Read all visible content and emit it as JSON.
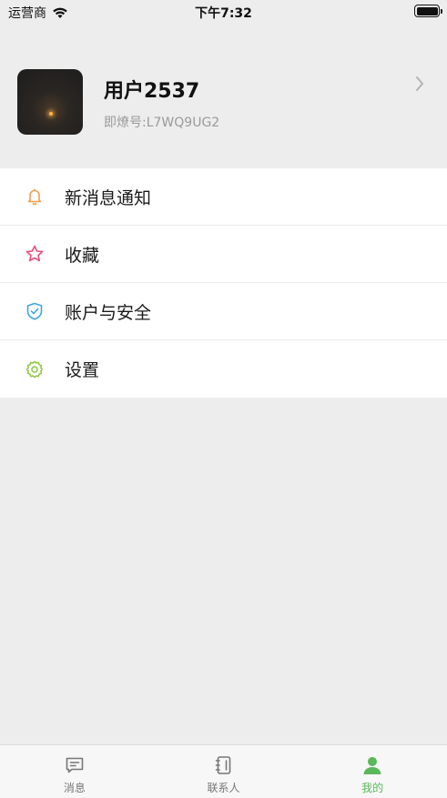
{
  "status_bar": {
    "carrier": "运营商",
    "time": "下午7:32"
  },
  "profile": {
    "username": "用户2537",
    "account_id": "即燎号:L7WQ9UG2"
  },
  "menu": {
    "items": [
      {
        "label": "新消息通知",
        "icon": "bell-icon",
        "color": "#f0a050"
      },
      {
        "label": "收藏",
        "icon": "star-icon",
        "color": "#e8507a"
      },
      {
        "label": "账户与安全",
        "icon": "shield-check-icon",
        "color": "#3fa8e0"
      },
      {
        "label": "设置",
        "icon": "gear-icon",
        "color": "#8cc63f"
      }
    ]
  },
  "tab_bar": {
    "tabs": [
      {
        "label": "消息",
        "icon": "message-icon",
        "active": false
      },
      {
        "label": "联系人",
        "icon": "contacts-book-icon",
        "active": false
      },
      {
        "label": "我的",
        "icon": "person-icon",
        "active": true
      }
    ],
    "active_color": "#59b85a",
    "inactive_color": "#777777"
  }
}
